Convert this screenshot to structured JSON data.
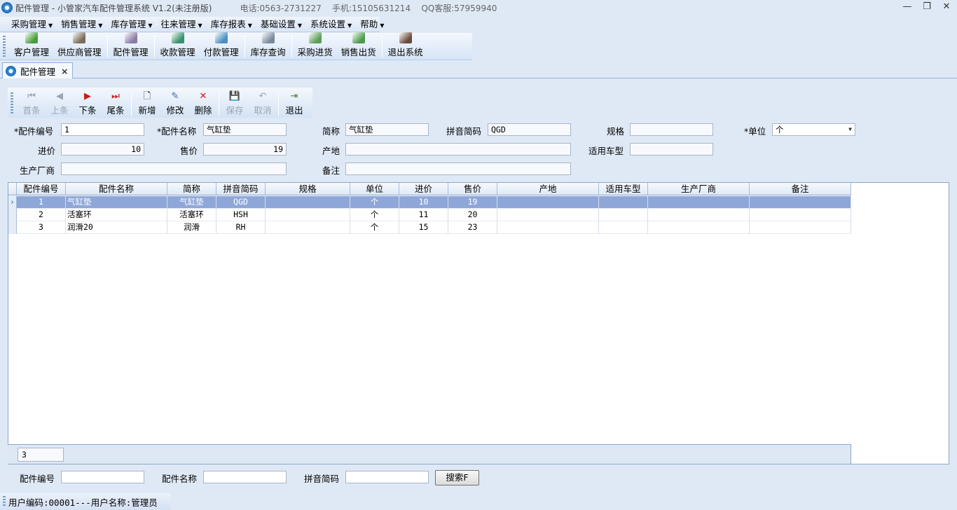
{
  "window": {
    "title": "配件管理 - 小管家汽车配件管理系统 V1.2(未注册版)",
    "contact": "电话:0563-2731227    手机:15105631214    QQ客服:57959940",
    "minimize": "—",
    "restore": "❐",
    "close": "✕"
  },
  "menu": [
    {
      "label": "采购管理"
    },
    {
      "label": "销售管理"
    },
    {
      "label": "库存管理"
    },
    {
      "label": "往来管理"
    },
    {
      "label": "库存报表"
    },
    {
      "label": "基础设置"
    },
    {
      "label": "系统设置"
    },
    {
      "label": "帮助"
    }
  ],
  "toolbar": [
    {
      "label": "客户管理",
      "icon": "customer-icon",
      "color": "#4a9d3b"
    },
    {
      "label": "供应商管理",
      "icon": "supplier-icon",
      "color": "#7a6d5a"
    },
    {
      "label": "配件管理",
      "icon": "parts-icon",
      "color": "#8a7aa8"
    },
    {
      "label": "收款管理",
      "icon": "receipt-icon",
      "color": "#3a8f6c"
    },
    {
      "label": "付款管理",
      "icon": "payment-icon",
      "color": "#4c8fc0"
    },
    {
      "label": "库存查询",
      "icon": "inventory-search-icon",
      "color": "#7a8a9a"
    },
    {
      "label": "采购进货",
      "icon": "purchase-icon",
      "color": "#5aa05a"
    },
    {
      "label": "销售出货",
      "icon": "sales-icon",
      "color": "#4d9a4d"
    },
    {
      "label": "退出系统",
      "icon": "exit-icon",
      "color": "#6a4a3a"
    }
  ],
  "tab": {
    "label": "配件管理",
    "close": "×"
  },
  "nav": {
    "first": {
      "label": "首条",
      "glyph": "⏮"
    },
    "prev": {
      "label": "上条",
      "glyph": "◀"
    },
    "next": {
      "label": "下条",
      "glyph": "▶"
    },
    "last": {
      "label": "尾条",
      "glyph": "⏭"
    },
    "add": {
      "label": "新增",
      "glyph": "🗋"
    },
    "edit": {
      "label": "修改",
      "glyph": "✎"
    },
    "delete": {
      "label": "删除",
      "glyph": "✕"
    },
    "save": {
      "label": "保存",
      "glyph": "💾"
    },
    "cancel": {
      "label": "取消",
      "glyph": "↶"
    },
    "exit": {
      "label": "退出",
      "glyph": "⇥"
    }
  },
  "form": {
    "part_no": {
      "label": "*配件编号",
      "value": "1"
    },
    "part_name": {
      "label": "*配件名称",
      "value": "气缸垫"
    },
    "short_name": {
      "label": "简称",
      "value": "气缸垫"
    },
    "pinyin": {
      "label": "拼音简码",
      "value": "QGD"
    },
    "spec": {
      "label": "规格",
      "value": ""
    },
    "unit": {
      "label": "*单位",
      "value": "个"
    },
    "buy_price": {
      "label": "进价",
      "value": "10"
    },
    "sell_price": {
      "label": "售价",
      "value": "19"
    },
    "origin": {
      "label": "产地",
      "value": ""
    },
    "vehicle": {
      "label": "适用车型",
      "value": ""
    },
    "maker": {
      "label": "生产厂商",
      "value": ""
    },
    "remark": {
      "label": "备注",
      "value": ""
    }
  },
  "grid": {
    "headers": [
      "配件编号",
      "配件名称",
      "简称",
      "拼音简码",
      "规格",
      "单位",
      "进价",
      "售价",
      "产地",
      "适用车型",
      "生产厂商",
      "备注"
    ],
    "rows": [
      [
        "1",
        "气缸垫",
        "气缸垫",
        "QGD",
        "",
        "个",
        "10",
        "19",
        "",
        "",
        "",
        ""
      ],
      [
        "2",
        "活塞环",
        "活塞环",
        "HSH",
        "",
        "个",
        "11",
        "20",
        "",
        "",
        "",
        ""
      ],
      [
        "3",
        "润滑20",
        "润滑",
        "RH",
        "",
        "个",
        "15",
        "23",
        "",
        "",
        "",
        ""
      ]
    ],
    "count": "3",
    "row_indicator": "›"
  },
  "search": {
    "part_no_label": "配件编号",
    "part_name_label": "配件名称",
    "pinyin_label": "拼音简码",
    "part_no": "",
    "part_name": "",
    "pinyin": "",
    "button": "搜索F"
  },
  "status": {
    "text": "用户编码:00001---用户名称:管理员"
  }
}
